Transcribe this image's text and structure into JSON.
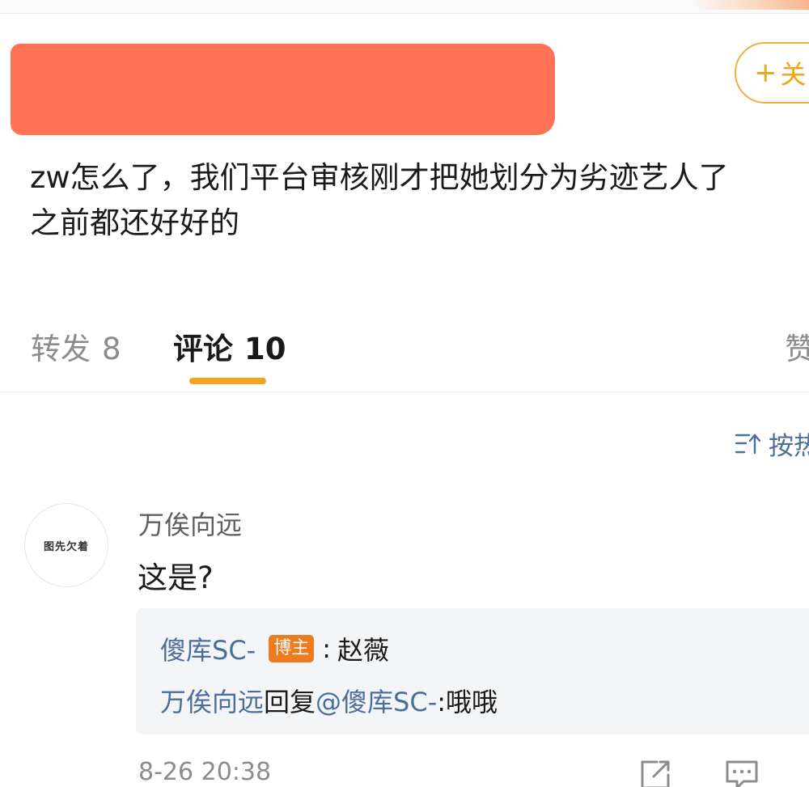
{
  "header": {
    "follow_label": "关"
  },
  "post": {
    "text_line_1": "zw怎么了，我们平台审核刚才把她划分为劣迹艺人了",
    "text_line_2": "之前都还好好的"
  },
  "tabs": {
    "repost_label": "转发",
    "repost_count": "8",
    "comments_label": "评论",
    "comments_count": "10",
    "likes_label": "赞"
  },
  "sort": {
    "label": "按热"
  },
  "comment": {
    "avatar_text": "图先欠着",
    "author": "万俟向远",
    "text": "这是?",
    "time": "8-26 20:38",
    "replies": [
      {
        "author": "傻库SC-",
        "badge": "博主",
        "separator": ":",
        "text": "赵薇"
      },
      {
        "author": "万俟向远",
        "action": "回复",
        "mention": "@傻库SC-",
        "text": ":哦哦"
      }
    ]
  },
  "icons": [
    "plus-icon",
    "sort-icon",
    "share-icon",
    "reply-icon"
  ],
  "colors": {
    "accent": "#f3a21c",
    "link": "#4a6f9d",
    "redaction": "#ff7256",
    "badge": "#f07a1e"
  }
}
